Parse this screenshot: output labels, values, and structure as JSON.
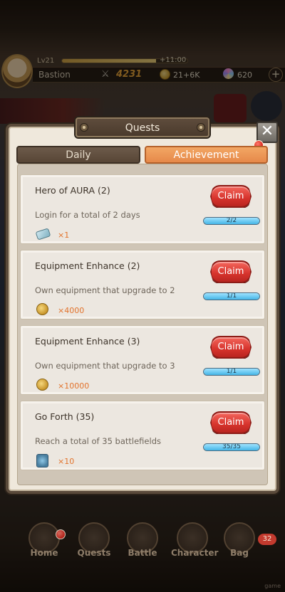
{
  "player": {
    "level": "Lv21",
    "xp_text": "+11:00",
    "name": "Bastion",
    "power": "4231",
    "gold": "21+6K",
    "gems": "620",
    "add_label": "+"
  },
  "modal": {
    "title": "Quests",
    "close_label": "✕"
  },
  "tabs": [
    {
      "label": "Daily",
      "active": false
    },
    {
      "label": "Achievement",
      "active": true
    }
  ],
  "quests": [
    {
      "title": "Hero of AURA (2)",
      "description": "Login for a total of 2 days",
      "reward_icon": "ticket-icon",
      "reward_qty": "×1",
      "claim_label": "Claim",
      "progress_text": "2/2",
      "progress": 1.0
    },
    {
      "title": "Equipment Enhance (2)",
      "description": "Own equipment that upgrade to 2",
      "reward_icon": "gold-coin-icon",
      "reward_qty": "×4000",
      "claim_label": "Claim",
      "progress_text": "1/1",
      "progress": 1.0
    },
    {
      "title": "Equipment Enhance (3)",
      "description": "Own equipment that upgrade to 3",
      "reward_icon": "gold-coin-icon",
      "reward_qty": "×10000",
      "claim_label": "Claim",
      "progress_text": "1/1",
      "progress": 1.0
    },
    {
      "title": "Go Forth (35)",
      "description": "Reach a total of 35 battlefields",
      "reward_icon": "scroll-icon",
      "reward_qty": "×10",
      "claim_label": "Claim",
      "progress_text": "35/35",
      "progress": 1.0
    }
  ],
  "nav": [
    {
      "label": "Home"
    },
    {
      "label": "Quests"
    },
    {
      "label": "Battle"
    },
    {
      "label": "Character"
    },
    {
      "label": "Bag"
    }
  ],
  "bag_badge": "32",
  "watermark": "game",
  "colors": {
    "claim_red": "#d6332c",
    "achievement_tab": "#e6894a",
    "progress_blue": "#45b5e6",
    "reward_qty": "#e2732c"
  }
}
